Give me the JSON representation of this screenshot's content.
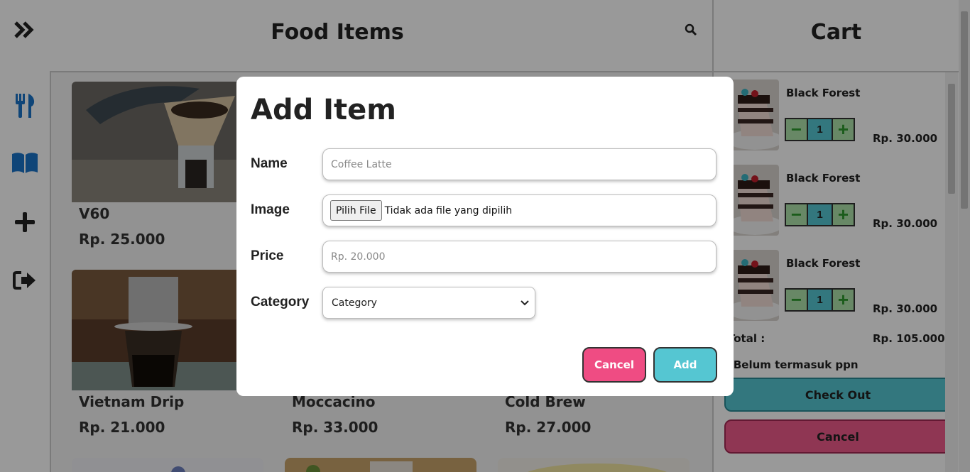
{
  "header": {
    "title": "Food Items"
  },
  "nav": {
    "items": [
      {
        "icon": "utensils-icon"
      },
      {
        "icon": "book-icon"
      },
      {
        "icon": "plus-icon"
      },
      {
        "icon": "logout-icon"
      }
    ]
  },
  "menu": {
    "items": [
      {
        "name": "V60",
        "price": "Rp. 25.000"
      },
      {
        "name": "Vietnam Drip",
        "price": "Rp. 21.000"
      },
      {
        "name": "Moccacino",
        "price": "Rp. 33.000"
      },
      {
        "name": "Cold Brew",
        "price": "Rp. 27.000"
      }
    ]
  },
  "cart": {
    "title": "Cart",
    "items": [
      {
        "name": "Black Forest",
        "qty": "1",
        "price": "Rp. 30.000"
      },
      {
        "name": "Black Forest",
        "qty": "1",
        "price": "Rp. 30.000"
      },
      {
        "name": "Black Forest",
        "qty": "1",
        "price": "Rp. 30.000"
      }
    ],
    "total_label": "Total :",
    "total_value": "Rp. 105.000*",
    "vat_note": "*Belum termasuk ppn",
    "checkout_label": "Check Out",
    "cancel_label": "Cancel"
  },
  "modal": {
    "title": "Add Item",
    "name_label": "Name",
    "name_placeholder": "Coffee Latte",
    "image_label": "Image",
    "file_button": "Pilih File",
    "file_status": "Tidak ada file yang dipilih",
    "price_label": "Price",
    "price_placeholder": "Rp. 20.000",
    "category_label": "Category",
    "category_selected": "Category",
    "cancel_label": "Cancel",
    "add_label": "Add"
  },
  "colors": {
    "accent_teal": "#55c6d2",
    "accent_pink": "#ef4c83",
    "icon_blue": "#1a73c9"
  }
}
